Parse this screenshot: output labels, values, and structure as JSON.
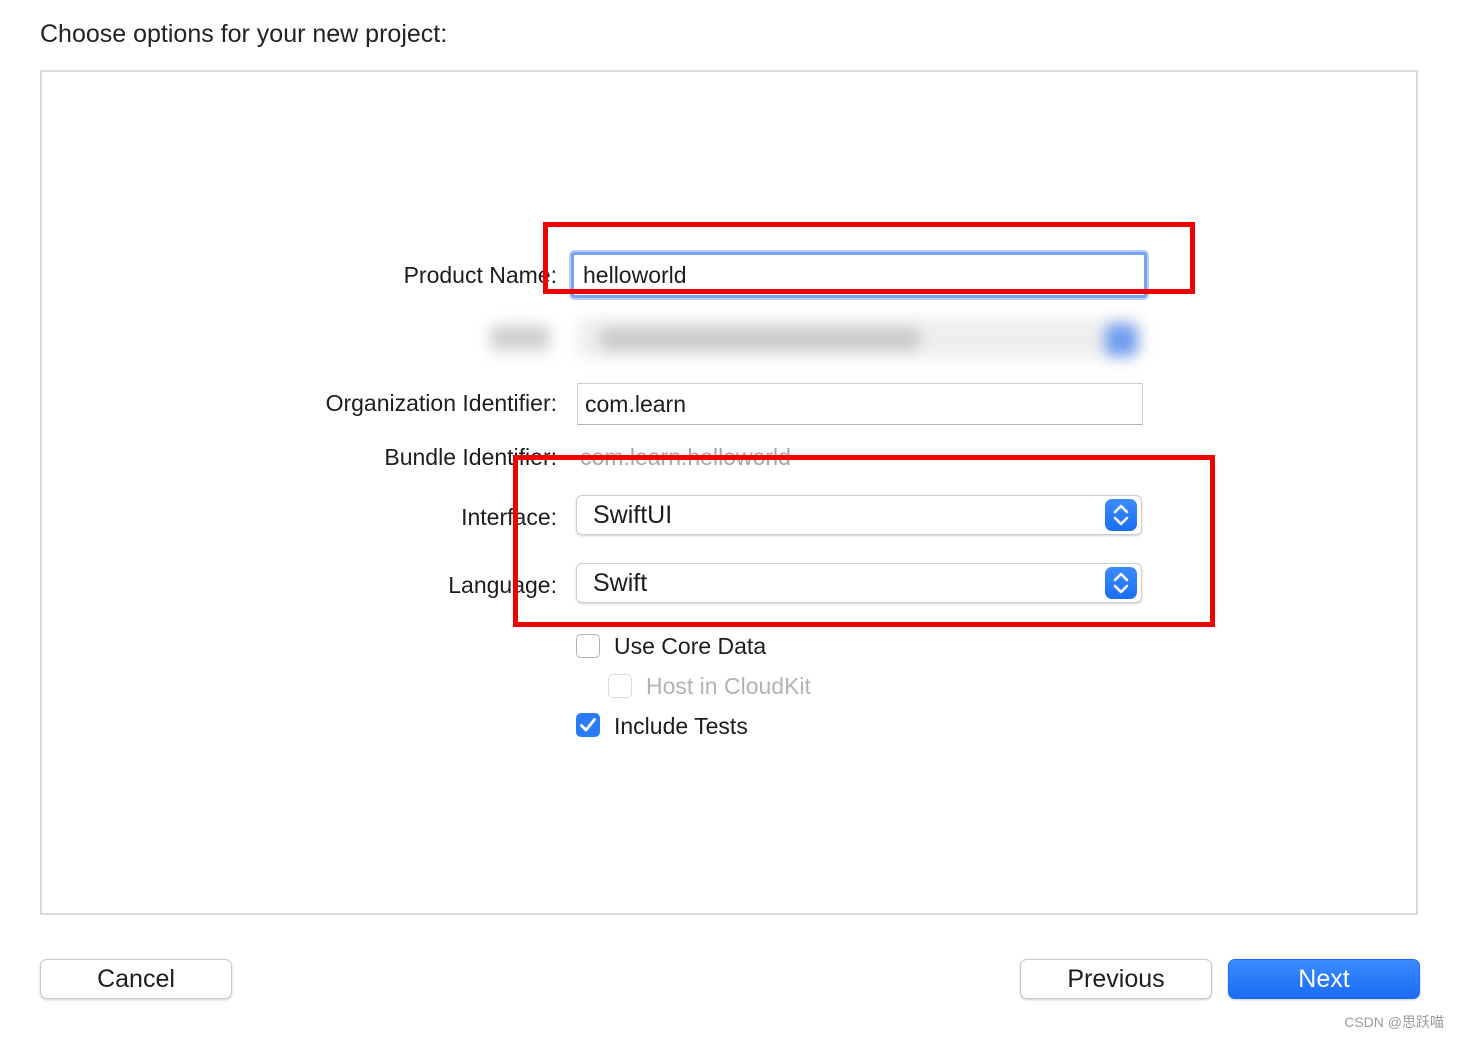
{
  "header": {
    "title": "Choose options for your new project:"
  },
  "form": {
    "product_name": {
      "label": "Product Name:",
      "value": "helloworld"
    },
    "organization_identifier": {
      "label": "Organization Identifier:",
      "value": "com.learn"
    },
    "bundle_identifier": {
      "label": "Bundle Identifier:",
      "value": "com.learn.helloworld"
    },
    "interface": {
      "label": "Interface:",
      "selected": "SwiftUI"
    },
    "language": {
      "label": "Language:",
      "selected": "Swift"
    },
    "use_core_data": {
      "label": "Use Core Data",
      "checked": false
    },
    "host_in_cloudkit": {
      "label": "Host in CloudKit",
      "checked": false,
      "enabled": false
    },
    "include_tests": {
      "label": "Include Tests",
      "checked": true
    }
  },
  "footer": {
    "cancel_label": "Cancel",
    "previous_label": "Previous",
    "next_label": "Next"
  },
  "colors": {
    "accent": "#1a6cf4",
    "annotation_red": "#f00000"
  },
  "watermark": "CSDN @思跃喵"
}
